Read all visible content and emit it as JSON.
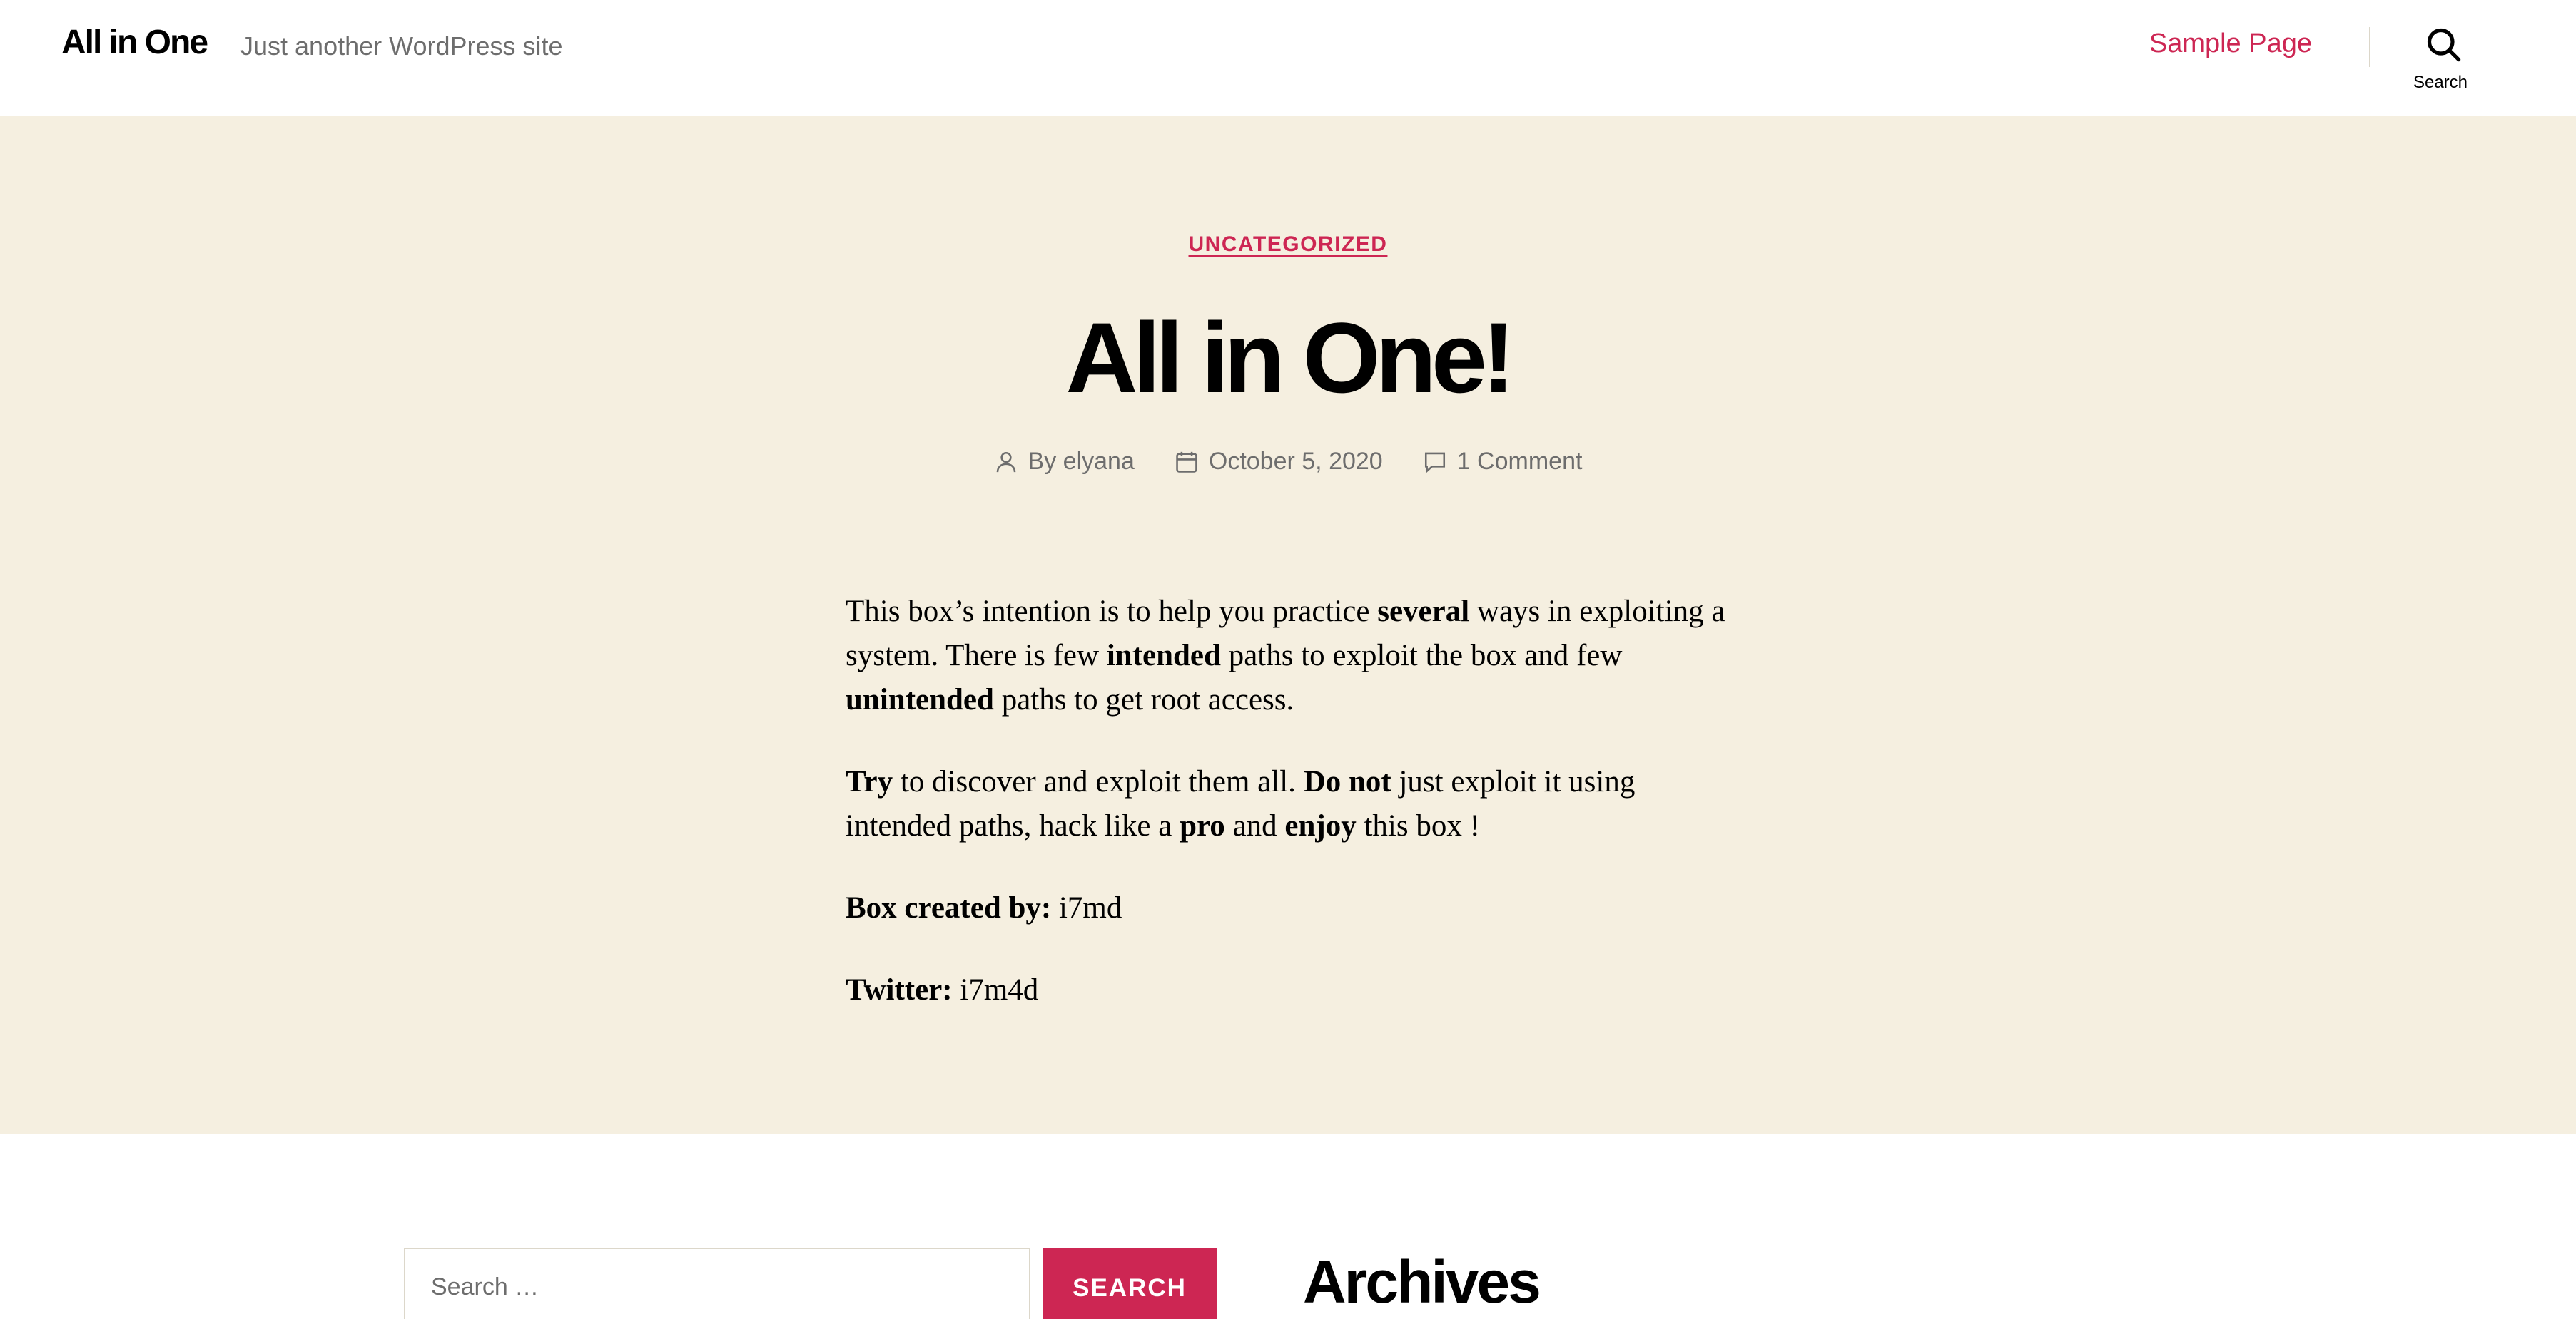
{
  "header": {
    "site_title": "All in One",
    "site_description": "Just another WordPress site",
    "nav_link": "Sample Page",
    "search_label": "Search"
  },
  "post": {
    "category": "UNCATEGORIZED",
    "title": "All in One!",
    "author": "By elyana",
    "date": "October 5, 2020",
    "comments": "1 Comment",
    "paragraphs": [
      {
        "pre": "This box’s intention is to help you practice ",
        "b1": "several",
        "mid1": " ways in exploiting a system. There is few ",
        "b2": "intended",
        "mid2": " paths to exploit the box and few ",
        "b3": "unintended",
        "post": " paths to get root access."
      },
      {
        "b1": "Try",
        "mid1": " to discover and exploit them all. ",
        "b2": "Do not",
        "mid2": " just exploit it using intended paths, hack like a ",
        "b3": "pro",
        "mid3": " and ",
        "b4": "enjoy",
        "post": " this box !"
      },
      {
        "label": "Box created by:",
        "value": " i7md"
      },
      {
        "label": "Twitter:",
        "value": " i7m4d"
      }
    ]
  },
  "footer": {
    "search_placeholder": "Search …",
    "search_button": "Search",
    "archives_title": "Archives"
  },
  "colors": {
    "accent": "#cd2653",
    "band_background": "#f5efe0",
    "muted_text": "#6d6d6d"
  }
}
